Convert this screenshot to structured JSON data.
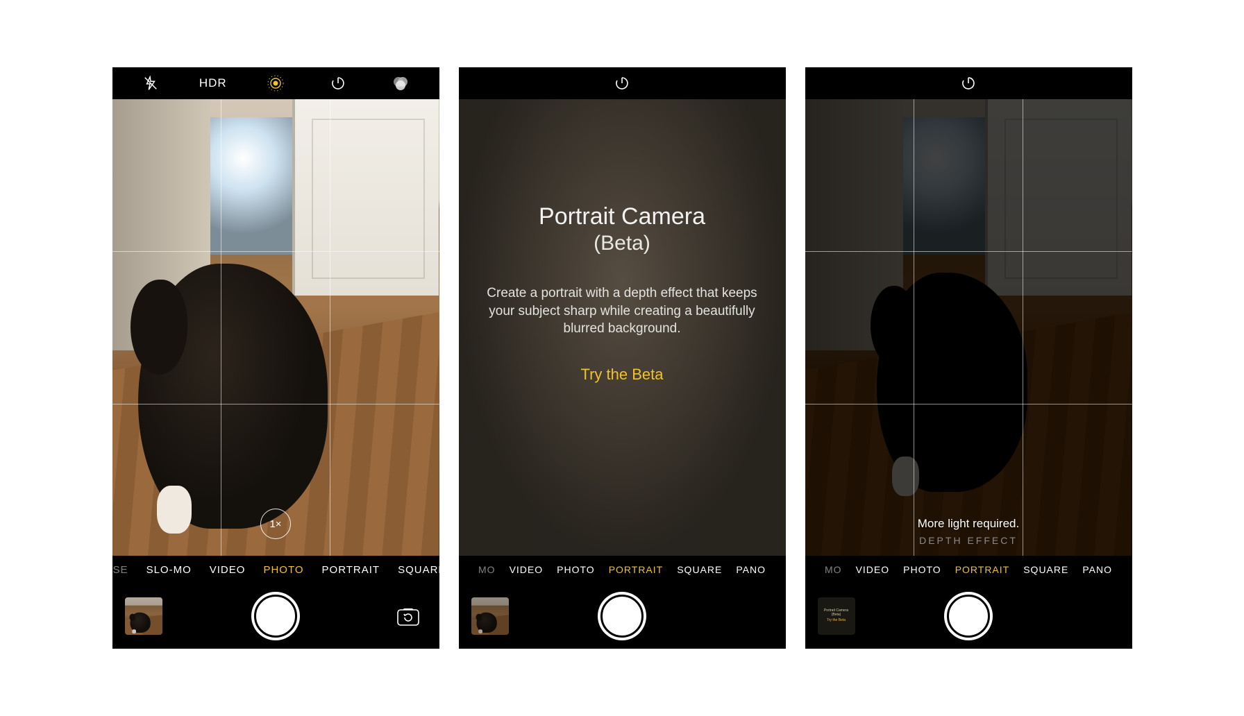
{
  "accent": "#f2c22e",
  "phone1": {
    "topbar": {
      "hdr": "HDR"
    },
    "zoom": "1×",
    "modes": {
      "left_frag": "PSE",
      "items": [
        "SLO-MO",
        "VIDEO",
        "PHOTO",
        "PORTRAIT",
        "SQUARE"
      ],
      "selected": "PHOTO"
    }
  },
  "phone2": {
    "intro": {
      "title": "Portrait Camera",
      "subtitle": "(Beta)",
      "description": "Create a portrait with a depth effect that keeps your subject sharp while creating a beautifully blurred background.",
      "cta": "Try the Beta"
    },
    "modes": {
      "left_frag": "MO",
      "items": [
        "VIDEO",
        "PHOTO",
        "PORTRAIT",
        "SQUARE",
        "PANO"
      ],
      "selected": "PORTRAIT"
    }
  },
  "phone3": {
    "status": "More light required.",
    "depth_label": "DEPTH EFFECT",
    "modes": {
      "left_frag": "MO",
      "items": [
        "VIDEO",
        "PHOTO",
        "PORTRAIT",
        "SQUARE",
        "PANO"
      ],
      "selected": "PORTRAIT"
    },
    "thumb": {
      "l1": "Portrait Camera",
      "l2": "(Beta)",
      "cta": "Try the Beta"
    }
  }
}
